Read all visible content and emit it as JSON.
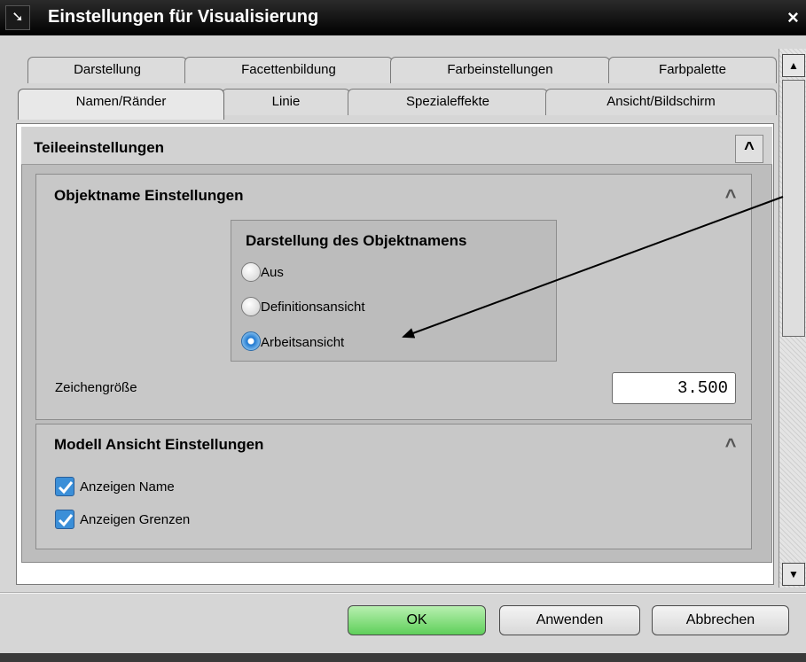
{
  "window": {
    "title": "Einstellungen für Visualisierung",
    "close_glyph": "×",
    "icon": "cursor-arrow-icon"
  },
  "tabs_row1": [
    {
      "label": "Darstellung"
    },
    {
      "label": "Facettenbildung"
    },
    {
      "label": "Farbeinstellungen"
    },
    {
      "label": "Farbpalette"
    }
  ],
  "tabs_row2": [
    {
      "label": "Namen/Ränder",
      "active": true
    },
    {
      "label": "Linie"
    },
    {
      "label": "Spezialeffekte"
    },
    {
      "label": "Ansicht/Bildschirm"
    }
  ],
  "section": {
    "title": "Teileeinstellungen",
    "collapse_glyph": "^"
  },
  "object_name": {
    "title": "Objektname Einstellungen",
    "group_title": "Darstellung des Objektnamens",
    "options": [
      {
        "label": "Aus",
        "checked": false
      },
      {
        "label": "Definitionsansicht",
        "checked": false
      },
      {
        "label": "Arbeitsansicht",
        "checked": true
      }
    ],
    "char_size_label": "Zeichengröße",
    "char_size_value": "3.500"
  },
  "model_view": {
    "title": "Modell Ansicht Einstellungen",
    "checkboxes": [
      {
        "label": "Anzeigen Name",
        "checked": true
      },
      {
        "label": "Anzeigen Grenzen",
        "checked": true
      }
    ]
  },
  "buttons": {
    "ok": "OK",
    "apply": "Anwenden",
    "cancel": "Abbrechen"
  },
  "scrollbar": {
    "up": "▲",
    "down": "▼"
  },
  "colors": {
    "ok_button": "#5fcf5a",
    "radio_selected": "#1e78d0",
    "checkbox": "#3b8fd8"
  }
}
